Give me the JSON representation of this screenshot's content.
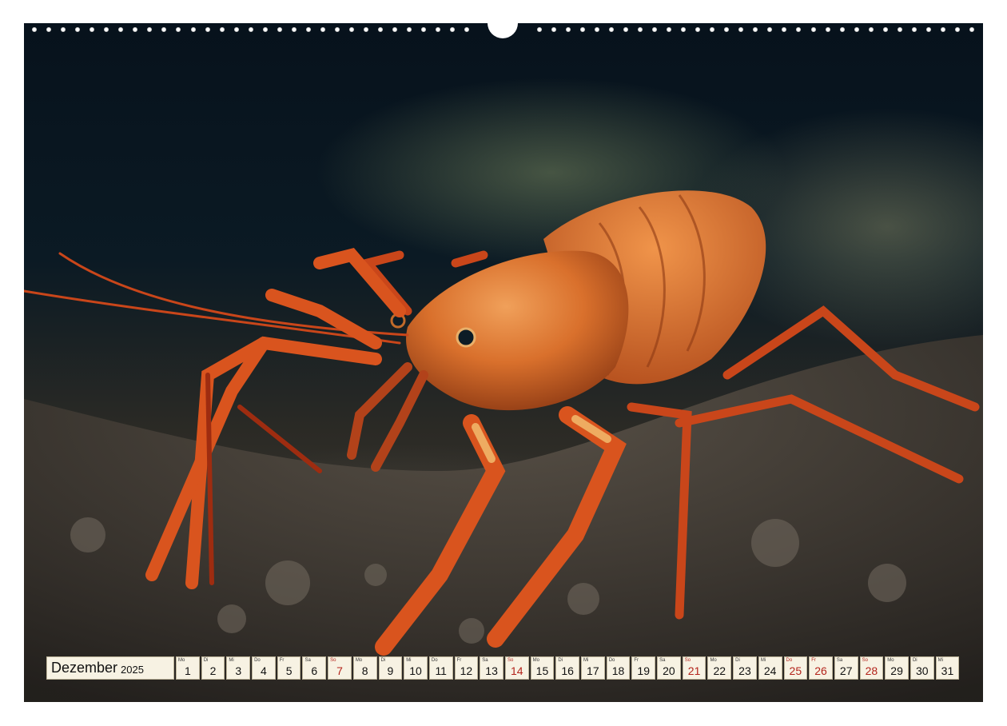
{
  "calendar": {
    "month": "Dezember",
    "year": "2025",
    "days": [
      {
        "wd": "Mo",
        "n": "1",
        "kind": "normal"
      },
      {
        "wd": "Di",
        "n": "2",
        "kind": "normal"
      },
      {
        "wd": "Mi",
        "n": "3",
        "kind": "normal"
      },
      {
        "wd": "Do",
        "n": "4",
        "kind": "normal"
      },
      {
        "wd": "Fr",
        "n": "5",
        "kind": "normal"
      },
      {
        "wd": "Sa",
        "n": "6",
        "kind": "normal"
      },
      {
        "wd": "So",
        "n": "7",
        "kind": "sun"
      },
      {
        "wd": "Mo",
        "n": "8",
        "kind": "normal"
      },
      {
        "wd": "Di",
        "n": "9",
        "kind": "normal"
      },
      {
        "wd": "Mi",
        "n": "10",
        "kind": "normal"
      },
      {
        "wd": "Do",
        "n": "11",
        "kind": "normal"
      },
      {
        "wd": "Fr",
        "n": "12",
        "kind": "normal"
      },
      {
        "wd": "Sa",
        "n": "13",
        "kind": "normal"
      },
      {
        "wd": "So",
        "n": "14",
        "kind": "sun"
      },
      {
        "wd": "Mo",
        "n": "15",
        "kind": "normal"
      },
      {
        "wd": "Di",
        "n": "16",
        "kind": "normal"
      },
      {
        "wd": "Mi",
        "n": "17",
        "kind": "normal"
      },
      {
        "wd": "Do",
        "n": "18",
        "kind": "normal"
      },
      {
        "wd": "Fr",
        "n": "19",
        "kind": "normal"
      },
      {
        "wd": "Sa",
        "n": "20",
        "kind": "normal"
      },
      {
        "wd": "So",
        "n": "21",
        "kind": "sun"
      },
      {
        "wd": "Mo",
        "n": "22",
        "kind": "normal"
      },
      {
        "wd": "Di",
        "n": "23",
        "kind": "normal"
      },
      {
        "wd": "Mi",
        "n": "24",
        "kind": "normal"
      },
      {
        "wd": "Do",
        "n": "25",
        "kind": "holiday"
      },
      {
        "wd": "Fr",
        "n": "26",
        "kind": "holiday"
      },
      {
        "wd": "Sa",
        "n": "27",
        "kind": "normal"
      },
      {
        "wd": "So",
        "n": "28",
        "kind": "sun"
      },
      {
        "wd": "Mo",
        "n": "29",
        "kind": "normal"
      },
      {
        "wd": "Di",
        "n": "30",
        "kind": "normal"
      },
      {
        "wd": "Mi",
        "n": "31",
        "kind": "normal"
      }
    ]
  },
  "colors": {
    "sunday_red": "#b3231b",
    "cell_background": "#f7f2e3",
    "crayfish_orange": "#d9541e"
  }
}
